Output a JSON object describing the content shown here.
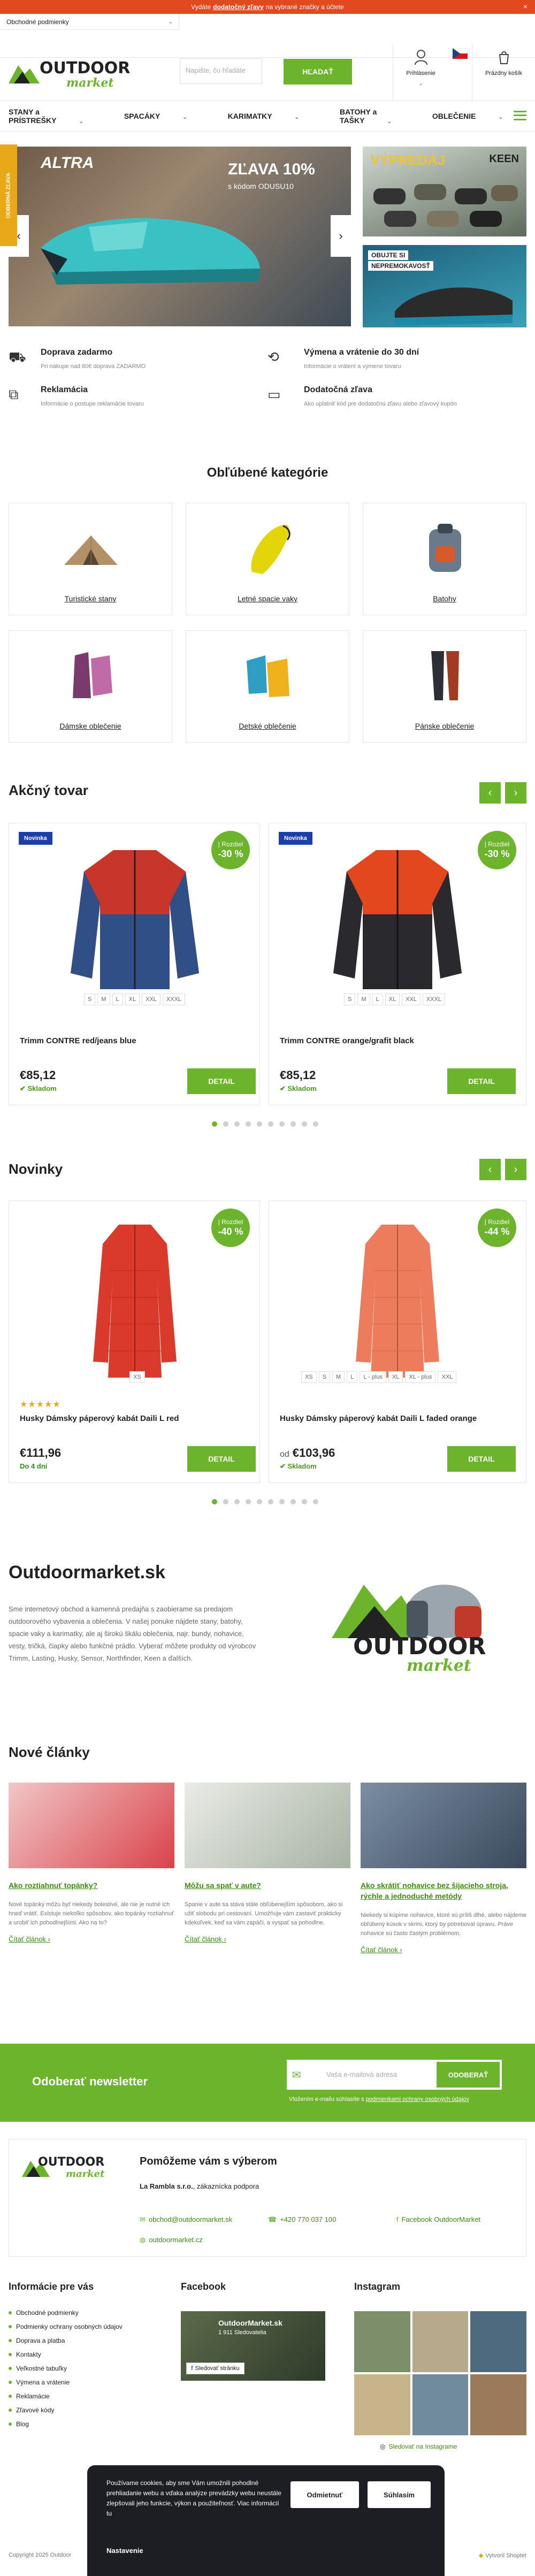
{
  "topbar": {
    "pre": "Vydáte",
    "link": "dodatočný zľavy",
    "post": "na vybrané značky a účtete",
    "close": "×"
  },
  "header": {
    "info_dropdown": "Obchodné podmienky",
    "logo_main": "OUTDOOR",
    "logo_sub": "market",
    "search_placeholder": "Napište, čo hľadáte",
    "search_button": "HĽADAŤ",
    "login": "Prihlásenie",
    "flag_caret": "⌄",
    "cart": "Prázdny košík"
  },
  "nav": {
    "items": [
      "STANY a PRÍSTREŠKY",
      "SPACÁKY",
      "KARIMATKY",
      "BATOHY a TAŠKY",
      "OBLEČENIE"
    ]
  },
  "side_tab": "ODBERNÁ ZĽAVA",
  "hero": {
    "headline": "ZĽAVA 10%",
    "sub": "s kódom ODUSU10",
    "brand": "ALTRA",
    "banner1_headline": "VÝPREDAJ",
    "banner1_brand": "KEEN",
    "banner2_line1": "OBUJTE SI",
    "banner2_line2": "NEPREMOKAVOSŤ"
  },
  "benefits": [
    {
      "title": "Doprava zadarmo",
      "text": "Pri nákupe nad 80€ doprava ZADARMO"
    },
    {
      "title": "Výmena a vrátenie do 30 dní",
      "text": "Informácie o vrátení a výmene tovaru"
    },
    {
      "title": "Reklamácia",
      "text": "Informácie o postupe reklamácie tovaru"
    },
    {
      "title": "Dodatočná zľava",
      "text": "Ako uplatniť kód pre dodatočnú zľavu alebo zľavový kupón"
    }
  ],
  "categories": {
    "title": "Obľúbené kategórie",
    "items": [
      "Turistické stany",
      "Letné spacie vaky",
      "Batohy",
      "Dámske oblečenie",
      "Detské oblečenie",
      "Pánske oblečenie"
    ]
  },
  "action": {
    "title": "Akčný tovar",
    "prev": "‹",
    "next": "›",
    "products": [
      {
        "badge": "Novinka",
        "disc_top": "| Rozdiel",
        "disc": "-30 %",
        "sizes": [
          "S",
          "M",
          "L",
          "XL",
          "XXL",
          "XXXL"
        ],
        "name": "Trimm CONTRE red/jeans blue",
        "price": "€85,12",
        "stock": "Skladom",
        "button": "DETAIL"
      },
      {
        "badge": "Novinka",
        "disc_top": "| Rozdiel",
        "disc": "-30 %",
        "sizes": [
          "S",
          "M",
          "L",
          "XL",
          "XXL",
          "XXXL"
        ],
        "name": "Trimm CONTRE orange/grafit black",
        "price": "€85,12",
        "stock": "Skladom",
        "button": "DETAIL"
      }
    ]
  },
  "novinky": {
    "title": "Novinky",
    "prev": "‹",
    "next": "›",
    "products": [
      {
        "disc_top": "| Rozdiel",
        "disc": "-40 %",
        "sizes": [
          "XS"
        ],
        "stars": "★★★★★",
        "name": "Husky Dámsky páperový kabát Daili L red",
        "price": "€111,96",
        "stock": "Do 4 dní",
        "button": "DETAIL"
      },
      {
        "disc_top": "| Rozdiel",
        "disc": "-44 %",
        "sizes": [
          "XS",
          "S",
          "M",
          "L",
          "L - plus",
          "XL",
          "XL - plus",
          "XXL"
        ],
        "name": "Husky Dámsky páperový kabát Daili L faded orange",
        "price_prefix": "od",
        "price": "€103,96",
        "stock": "Skladom",
        "button": "DETAIL"
      }
    ]
  },
  "about": {
    "title": "Outdoormarket.sk",
    "text": "Sme internetový obchod a kamenná predajňa s zaobierame sa predajom outdoorového vybavenia a oblečenia. V našej ponuke nájdete stany, batohy, spacie vaky a karimatky, ale aj širokú škálu oblečenia, najr. bundy, nohavice, vesty, tričká, čiapky alebo funkčné prádlo. Vyberať môžete produkty od výrobcov Trimm, Lasting, Husky, Sensor, Northfinder, Keen a ďalších."
  },
  "articles": {
    "title": "Nové články",
    "items": [
      {
        "title": "Ako roztiahnuť topánky?",
        "text": "Nové topánky môžu byť niekedy bolestivé, ale nie je nutné ich hneď vrátiť. Existuje niekoľko spôsobov, ako topánky roztiahnuť a urobiť ich pohodlnejšími. Ako na to?",
        "more": "Čítať článok"
      },
      {
        "title": "Môžu sa spať v aute?",
        "text": "Spanie v aute sa stáva stále obľúbenejším spôsobom, ako si užiť slobodu pri cestovaní. Umožňuje vám zastaviť prakticky kdekoľvek, keď sa vám zapáči, a vyspať sa pohodlne.",
        "more": "Čítať článok"
      },
      {
        "title": "Ako skrátiť nohavice bez šijacieho stroja, rýchle a jednoduché metódy",
        "text": "Niekedy si kúpime nohavice, ktoré sú príliš dlhé, alebo nájdeme obľúbený kúsok v skrini, ktorý by potreboval úpravu. Práve nohavice sú často častým problémom.",
        "more": "Čítať článok"
      }
    ]
  },
  "newsletter": {
    "title": "Odoberať newsletter",
    "placeholder": "Vaša e-mailová adresa",
    "button": "ODOBERAŤ",
    "consent_pre": "Vložením e-mailu súhlasíte s",
    "consent_link": "podmienkami ochrany osobných údajov"
  },
  "help": {
    "title": "Pomôžeme vám s výberom",
    "sub_bold": "La Rambla s.r.o.",
    "sub": ", zákaznícka podpora",
    "email": "obchod@outdoormarket.sk",
    "phone": "+420 770 037 100",
    "facebook": "Facebook OutdoorMarket",
    "web": "outdoormarket.cz"
  },
  "footer": {
    "info_title": "Informácie pre vás",
    "info_items": [
      "Obchodné podmienky",
      "Podmienky ochrany osobných údajov",
      "Doprava a platba",
      "Kontakty",
      "Veľkostné tabuľky",
      "Výmena a vrátenie",
      "Reklamácie",
      "Zľavové kódy",
      "Blog"
    ],
    "fb_title": "Facebook",
    "fb_page": "OutdoorMarket.sk",
    "fb_likes": "1 911 Sledovatelia",
    "fb_like_btn": "Sledovať stránku",
    "ig_title": "Instagram",
    "ig_follow": "Sledovať na Instagrame",
    "copyright": "Copyright 2025 Outdoor",
    "shoptet": "Vytvoril Shoptet"
  },
  "cookie": {
    "text": "Používame cookies, aby sme Vám umožnili pohodlné prehliadanie webu a vďaka analýze prevádzky webu neustále zlepšovali jeho funkcie, výkon a použiteľnosť. Viac informácií tu",
    "deny": "Odmietnuť",
    "accept": "Súhlasím",
    "settings": "Nastavenie"
  },
  "colors": {
    "brand_green": "#6cb42c",
    "topbar": "#e14a1e",
    "badge_blue": "#1d3da8",
    "cookie_bg": "#1d1d24"
  }
}
